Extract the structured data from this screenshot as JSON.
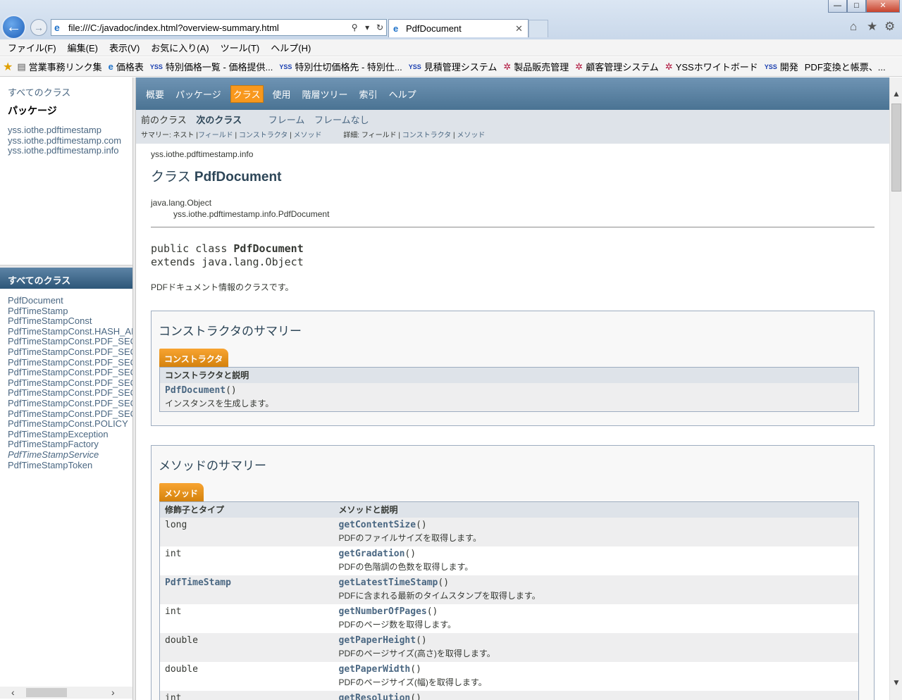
{
  "browser": {
    "address": "file:///C:/javadoc/index.html?overview-summary.html",
    "tab_title": "PdfDocument",
    "window_controls": {
      "minimize": "—",
      "maximize": "□",
      "close": "✕"
    }
  },
  "menubar": [
    "ファイル(F)",
    "編集(E)",
    "表示(V)",
    "お気に入り(A)",
    "ツール(T)",
    "ヘルプ(H)"
  ],
  "favorites": [
    {
      "label": "営業事務リンク集",
      "icon": "doc"
    },
    {
      "label": "価格表",
      "icon": "ie"
    },
    {
      "label": "特別価格一覧 - 価格提供...",
      "icon": "yss"
    },
    {
      "label": "特別仕切価格先 - 特別仕...",
      "icon": "yss"
    },
    {
      "label": "見積管理システム",
      "icon": "yss"
    },
    {
      "label": "製品販売管理",
      "icon": "red"
    },
    {
      "label": "顧客管理システム",
      "icon": "red"
    },
    {
      "label": "YSSホワイトボード",
      "icon": "red"
    },
    {
      "label": "開発",
      "icon": "yss"
    },
    {
      "label": "PDF変換と帳票、...",
      "icon": "none"
    }
  ],
  "left_top": {
    "all_classes_link": "すべてのクラス",
    "packages_title": "パッケージ",
    "packages": [
      "yss.iothe.pdftimestamp",
      "yss.iothe.pdftimestamp.com",
      "yss.iothe.pdftimestamp.info"
    ]
  },
  "left_bottom": {
    "header": "すべてのクラス",
    "classes": [
      "PdfDocument",
      "PdfTimeStamp",
      "PdfTimeStampConst",
      "PdfTimeStampConst.HASH_AL",
      "PdfTimeStampConst.PDF_SEC",
      "PdfTimeStampConst.PDF_SEC",
      "PdfTimeStampConst.PDF_SEC",
      "PdfTimeStampConst.PDF_SEC",
      "PdfTimeStampConst.PDF_SEC",
      "PdfTimeStampConst.PDF_SEC",
      "PdfTimeStampConst.PDF_SEC",
      "PdfTimeStampConst.PDF_SEC",
      "PdfTimeStampConst.POLICY",
      "PdfTimeStampException",
      "PdfTimeStampFactory",
      "PdfTimeStampService",
      "PdfTimeStampToken"
    ],
    "italic_class": "PdfTimeStampService"
  },
  "topnav": [
    "概要",
    "パッケージ",
    "クラス",
    "使用",
    "階層ツリー",
    "索引",
    "ヘルプ"
  ],
  "subnav": {
    "prev_class": "前のクラス",
    "next_class": "次のクラス",
    "frames": "フレーム",
    "no_frames": "フレームなし",
    "summary_label": "サマリー: ネスト |",
    "summary_field": "フィールド",
    "summary_sep1": " | ",
    "summary_ctor": "コンストラクタ",
    "summary_sep2": " | ",
    "summary_method": "メソッド",
    "detail_label": "詳細:",
    "detail_field": "フィールド",
    "detail_sep1": " | ",
    "detail_ctor": "コンストラクタ",
    "detail_sep2": " | ",
    "detail_method": "メソッド"
  },
  "class_page": {
    "package": "yss.iothe.pdftimestamp.info",
    "title_prefix": "クラス",
    "title_name": "PdfDocument",
    "inherit_parent": "java.lang.Object",
    "inherit_child": "yss.iothe.pdftimestamp.info.PdfDocument",
    "decl_line1_prefix": "public class ",
    "decl_line1_name": "PdfDocument",
    "decl_line2": "extends java.lang.Object",
    "description": "PDFドキュメント情報のクラスです。"
  },
  "constructor_summary": {
    "title": "コンストラクタのサマリー",
    "tab": "コンストラクタ",
    "header": "コンストラクタと説明",
    "name": "PdfDocument",
    "parens": "()",
    "desc": "インスタンスを生成します。"
  },
  "method_summary": {
    "title": "メソッドのサマリー",
    "tab": "メソッド",
    "col1": "修飾子とタイプ",
    "col2": "メソッドと説明",
    "rows": [
      {
        "type": "long",
        "type_link": false,
        "name": "getContentSize",
        "parens": "()",
        "desc": "PDFのファイルサイズを取得します。"
      },
      {
        "type": "int",
        "type_link": false,
        "name": "getGradation",
        "parens": "()",
        "desc": "PDFの色階調の色数を取得します。"
      },
      {
        "type": "PdfTimeStamp",
        "type_link": true,
        "name": "getLatestTimeStamp",
        "parens": "()",
        "desc": "PDFに含まれる最新のタイムスタンプを取得します。"
      },
      {
        "type": "int",
        "type_link": false,
        "name": "getNumberOfPages",
        "parens": "()",
        "desc": "PDFのページ数を取得します。"
      },
      {
        "type": "double",
        "type_link": false,
        "name": "getPaperHeight",
        "parens": "()",
        "desc": "PDFのページサイズ(高さ)を取得します。"
      },
      {
        "type": "double",
        "type_link": false,
        "name": "getPaperWidth",
        "parens": "()",
        "desc": "PDFのページサイズ(幅)を取得します。"
      },
      {
        "type": "int",
        "type_link": false,
        "name": "getResolution",
        "parens": "()",
        "desc": ""
      }
    ]
  }
}
